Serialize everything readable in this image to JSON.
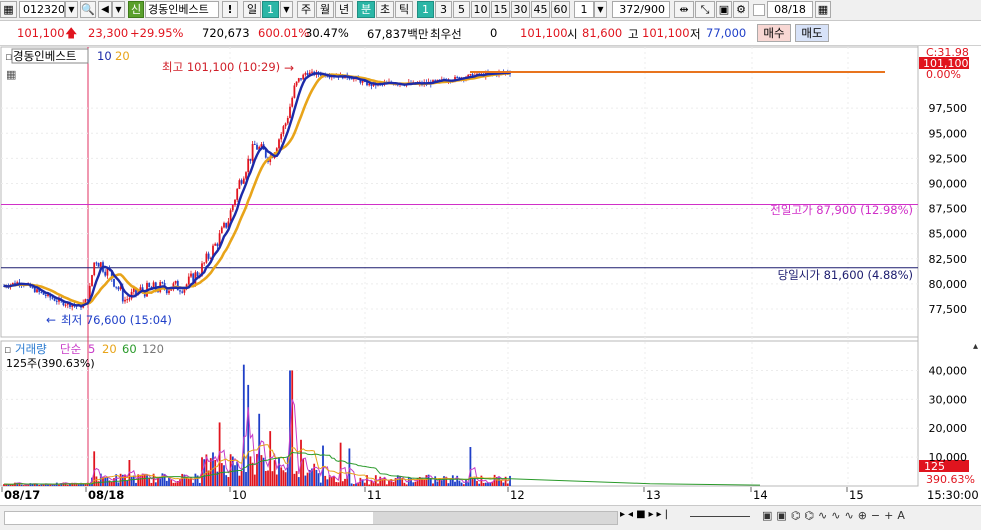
{
  "toolbar": {
    "code": "012320",
    "name": "경동인베스트",
    "sin": "신",
    "alert": "!",
    "periods": [
      "일",
      "1",
      "주",
      "월",
      "년",
      "분",
      "초",
      "틱"
    ],
    "intervals": [
      "1",
      "3",
      "5",
      "10",
      "15",
      "30",
      "45",
      "60"
    ],
    "count_value": "1",
    "range": "372/900",
    "date": "08/18"
  },
  "info": {
    "price": "101,100",
    "change": "23,300",
    "rate": "+29.95%",
    "volume": "720,673",
    "vol_ratio": "600.01%",
    "turnover": "30.47%",
    "amount": "67,837백만",
    "best_label": "최우선",
    "best_val": "0",
    "cur": "101,100",
    "open_label": "시",
    "open": "81,600",
    "high_label": "고",
    "high": "101,100",
    "low_label": "저",
    "low": "77,000",
    "buy": "매수",
    "sell": "매도"
  },
  "legend": {
    "name": "경동인베스트",
    "ma1": "10",
    "ma2": "20",
    "vol_label": "거래량",
    "vol_type": "단순",
    "vma": [
      "5",
      "20",
      "60",
      "120"
    ],
    "vol_note": "125주(390.63%)"
  },
  "annotations": {
    "high": "최고 101,100 (10:29)",
    "low": "최저 76,600 (15:04)",
    "prev_high": "전일고가 87,900 (12.98%)",
    "open_line": "당일시가 81,600 (4.88%)"
  },
  "price_axis": {
    "top_label": "C:31.98",
    "current": "101,100",
    "pct": "0.00%",
    "ticks": [
      "97,500",
      "95,000",
      "92,500",
      "90,000",
      "87,500",
      "85,000",
      "82,500",
      "80,000",
      "77,500"
    ]
  },
  "vol_axis": {
    "ticks": [
      "40,000",
      "30,000",
      "20,000",
      "10,000"
    ],
    "current": "125",
    "pct": "390.63%"
  },
  "time_axis": [
    "08/17",
    "08/18",
    "10",
    "11",
    "12",
    "13",
    "14",
    "15",
    "15:30:00"
  ],
  "colors": {
    "up": "#e0141e",
    "down": "#1f3fc8",
    "ma10": "#1c2aa8",
    "ma20": "#e8a419",
    "prev_high": "#d030c8",
    "open_line": "#1b1b6e"
  }
}
